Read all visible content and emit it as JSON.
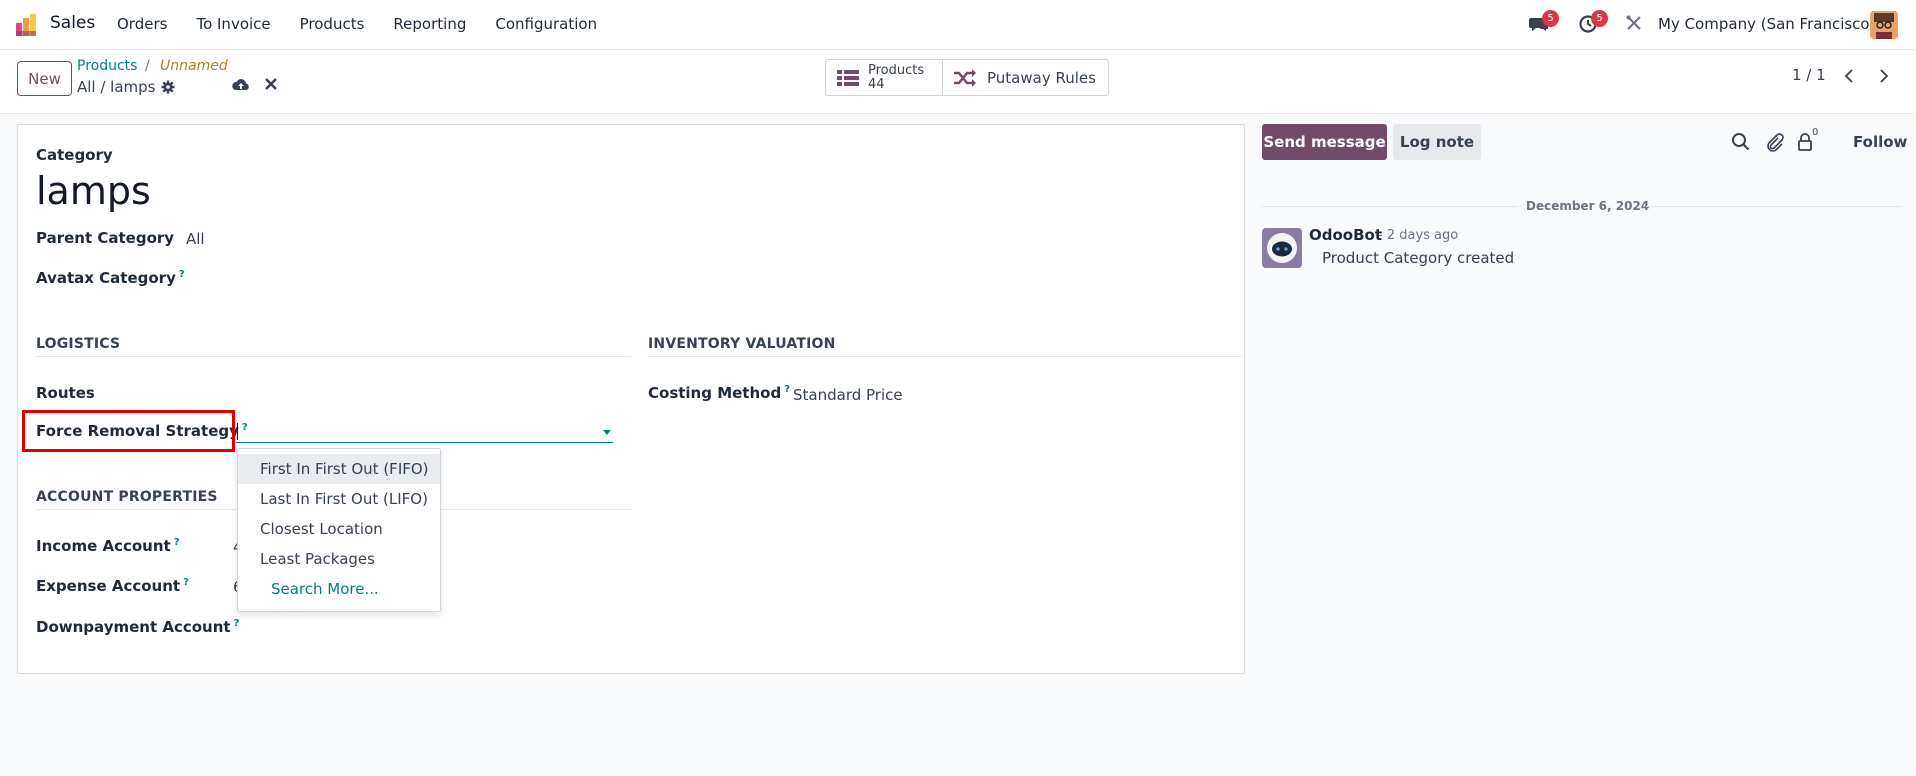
{
  "navbar": {
    "app_name": "Sales",
    "menu": [
      "Orders",
      "To Invoice",
      "Products",
      "Reporting",
      "Configuration"
    ],
    "messages_count": "5",
    "activities_count": "5",
    "company": "My Company (San Francisco)"
  },
  "control": {
    "new_label": "New",
    "breadcrumb_parent": "Products",
    "breadcrumb_sep": "/",
    "breadcrumb_unnamed": "Unnamed",
    "breadcrumb_current": "All / lamps",
    "smart_products_label": "Products",
    "smart_products_count": "44",
    "smart_putaway_label": "Putaway Rules",
    "pager": "1 / 1"
  },
  "form": {
    "category_label": "Category",
    "title": "lamps",
    "parent_category_label": "Parent Category",
    "parent_category_value": "All",
    "avatax_label": "Avatax Category",
    "help_mark": "?",
    "logistics_title": "LOGISTICS",
    "routes_label": "Routes",
    "force_removal_label": "Force Removal Strategy",
    "inventory_title": "INVENTORY VALUATION",
    "costing_label": "Costing Method",
    "costing_value": "Standard Price",
    "account_title": "ACCOUNT PROPERTIES",
    "income_label": "Income Account",
    "income_value_partial": "4",
    "expense_label": "Expense Account",
    "expense_value_partial": "6",
    "downpayment_label": "Downpayment Account"
  },
  "dropdown": {
    "items": [
      "First In First Out (FIFO)",
      "Last In First Out (LIFO)",
      "Closest Location",
      "Least Packages"
    ],
    "search_more": "Search More..."
  },
  "chatter": {
    "send_label": "Send message",
    "log_label": "Log note",
    "followers_count": "0",
    "follow_label": "Follow",
    "date": "December 6, 2024",
    "author": "OdooBot",
    "time": "- 2 days ago",
    "message": "Product Category created"
  },
  "colors": {
    "brand": "#714b67",
    "link": "#017e84",
    "badge": "#dc3545",
    "highlight": "#e00000"
  }
}
